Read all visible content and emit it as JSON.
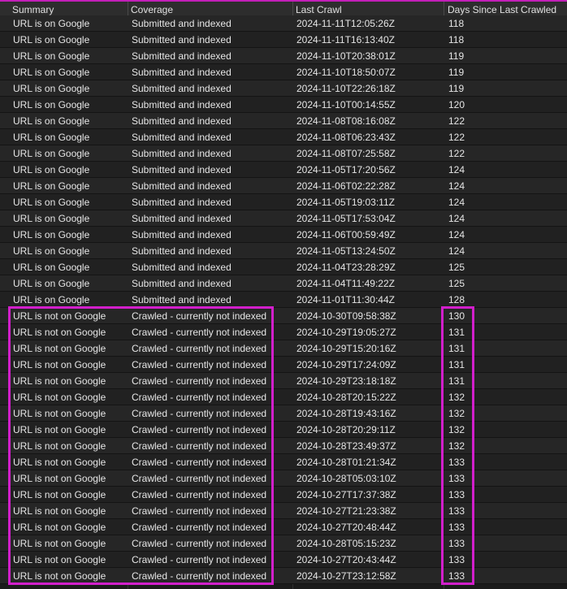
{
  "columns": [
    "Summary",
    "Coverage",
    "Last Crawl",
    "Days Since Last Crawled"
  ],
  "rows": [
    [
      "URL is on Google",
      "Submitted and indexed",
      "2024-11-11T12:05:26Z",
      "118"
    ],
    [
      "URL is on Google",
      "Submitted and indexed",
      "2024-11-11T16:13:40Z",
      "118"
    ],
    [
      "URL is on Google",
      "Submitted and indexed",
      "2024-11-10T20:38:01Z",
      "119"
    ],
    [
      "URL is on Google",
      "Submitted and indexed",
      "2024-11-10T18:50:07Z",
      "119"
    ],
    [
      "URL is on Google",
      "Submitted and indexed",
      "2024-11-10T22:26:18Z",
      "119"
    ],
    [
      "URL is on Google",
      "Submitted and indexed",
      "2024-11-10T00:14:55Z",
      "120"
    ],
    [
      "URL is on Google",
      "Submitted and indexed",
      "2024-11-08T08:16:08Z",
      "122"
    ],
    [
      "URL is on Google",
      "Submitted and indexed",
      "2024-11-08T06:23:43Z",
      "122"
    ],
    [
      "URL is on Google",
      "Submitted and indexed",
      "2024-11-08T07:25:58Z",
      "122"
    ],
    [
      "URL is on Google",
      "Submitted and indexed",
      "2024-11-05T17:20:56Z",
      "124"
    ],
    [
      "URL is on Google",
      "Submitted and indexed",
      "2024-11-06T02:22:28Z",
      "124"
    ],
    [
      "URL is on Google",
      "Submitted and indexed",
      "2024-11-05T19:03:11Z",
      "124"
    ],
    [
      "URL is on Google",
      "Submitted and indexed",
      "2024-11-05T17:53:04Z",
      "124"
    ],
    [
      "URL is on Google",
      "Submitted and indexed",
      "2024-11-06T00:59:49Z",
      "124"
    ],
    [
      "URL is on Google",
      "Submitted and indexed",
      "2024-11-05T13:24:50Z",
      "124"
    ],
    [
      "URL is on Google",
      "Submitted and indexed",
      "2024-11-04T23:28:29Z",
      "125"
    ],
    [
      "URL is on Google",
      "Submitted and indexed",
      "2024-11-04T11:49:22Z",
      "125"
    ],
    [
      "URL is on Google",
      "Submitted and indexed",
      "2024-11-01T11:30:44Z",
      "128"
    ],
    [
      "URL is not on Google",
      "Crawled - currently not indexed",
      "2024-10-30T09:58:38Z",
      "130"
    ],
    [
      "URL is not on Google",
      "Crawled - currently not indexed",
      "2024-10-29T19:05:27Z",
      "131"
    ],
    [
      "URL is not on Google",
      "Crawled - currently not indexed",
      "2024-10-29T15:20:16Z",
      "131"
    ],
    [
      "URL is not on Google",
      "Crawled - currently not indexed",
      "2024-10-29T17:24:09Z",
      "131"
    ],
    [
      "URL is not on Google",
      "Crawled - currently not indexed",
      "2024-10-29T23:18:18Z",
      "131"
    ],
    [
      "URL is not on Google",
      "Crawled - currently not indexed",
      "2024-10-28T20:15:22Z",
      "132"
    ],
    [
      "URL is not on Google",
      "Crawled - currently not indexed",
      "2024-10-28T19:43:16Z",
      "132"
    ],
    [
      "URL is not on Google",
      "Crawled - currently not indexed",
      "2024-10-28T20:29:11Z",
      "132"
    ],
    [
      "URL is not on Google",
      "Crawled - currently not indexed",
      "2024-10-28T23:49:37Z",
      "132"
    ],
    [
      "URL is not on Google",
      "Crawled - currently not indexed",
      "2024-10-28T01:21:34Z",
      "133"
    ],
    [
      "URL is not on Google",
      "Crawled - currently not indexed",
      "2024-10-28T05:03:10Z",
      "133"
    ],
    [
      "URL is not on Google",
      "Crawled - currently not indexed",
      "2024-10-27T17:37:38Z",
      "133"
    ],
    [
      "URL is not on Google",
      "Crawled - currently not indexed",
      "2024-10-27T21:23:38Z",
      "133"
    ],
    [
      "URL is not on Google",
      "Crawled - currently not indexed",
      "2024-10-27T20:48:44Z",
      "133"
    ],
    [
      "URL is not on Google",
      "Crawled - currently not indexed",
      "2024-10-28T05:15:23Z",
      "133"
    ],
    [
      "URL is not on Google",
      "Crawled - currently not indexed",
      "2024-10-27T20:43:44Z",
      "133"
    ],
    [
      "URL is not on Google",
      "Crawled - currently not indexed",
      "2024-10-27T23:12:58Z",
      "133"
    ]
  ],
  "colors": {
    "highlight": "#d21fcb",
    "background": "#1b1b1b",
    "header_background": "#2d2d2d",
    "text": "#e6e6e6"
  }
}
